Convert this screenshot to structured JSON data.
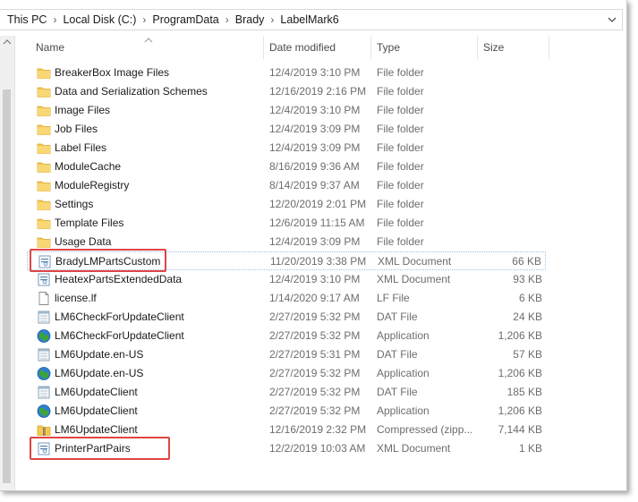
{
  "address_bar": {
    "crumbs": [
      "This PC",
      "Local Disk (C:)",
      "ProgramData",
      "Brady",
      "LabelMark6"
    ]
  },
  "columns": {
    "name": "Name",
    "date": "Date modified",
    "type": "Type",
    "size": "Size"
  },
  "files": [
    {
      "name": "BreakerBox Image Files",
      "date": "12/4/2019 3:10 PM",
      "type": "File folder",
      "size": "",
      "icon": "folder-icon"
    },
    {
      "name": "Data and Serialization Schemes",
      "date": "12/16/2019 2:16 PM",
      "type": "File folder",
      "size": "",
      "icon": "folder-icon"
    },
    {
      "name": "Image Files",
      "date": "12/4/2019 3:10 PM",
      "type": "File folder",
      "size": "",
      "icon": "folder-icon"
    },
    {
      "name": "Job Files",
      "date": "12/4/2019 3:09 PM",
      "type": "File folder",
      "size": "",
      "icon": "folder-icon"
    },
    {
      "name": "Label Files",
      "date": "12/4/2019 3:09 PM",
      "type": "File folder",
      "size": "",
      "icon": "folder-icon"
    },
    {
      "name": "ModuleCache",
      "date": "8/16/2019 9:36 AM",
      "type": "File folder",
      "size": "",
      "icon": "folder-icon"
    },
    {
      "name": "ModuleRegistry",
      "date": "8/14/2019 9:37 AM",
      "type": "File folder",
      "size": "",
      "icon": "folder-icon"
    },
    {
      "name": "Settings",
      "date": "12/20/2019 2:01 PM",
      "type": "File folder",
      "size": "",
      "icon": "folder-icon"
    },
    {
      "name": "Template Files",
      "date": "12/6/2019 11:15 AM",
      "type": "File folder",
      "size": "",
      "icon": "folder-icon"
    },
    {
      "name": "Usage Data",
      "date": "12/4/2019 3:09 PM",
      "type": "File folder",
      "size": "",
      "icon": "folder-icon"
    },
    {
      "name": "BradyLMPartsCustom",
      "date": "11/20/2019 3:38 PM",
      "type": "XML Document",
      "size": "66 KB",
      "icon": "xml-document-icon",
      "highlighted": true,
      "selected": true
    },
    {
      "name": "HeatexPartsExtendedData",
      "date": "12/4/2019 3:10 PM",
      "type": "XML Document",
      "size": "93 KB",
      "icon": "xml-document-icon"
    },
    {
      "name": "license.lf",
      "date": "1/14/2020 9:17 AM",
      "type": "LF File",
      "size": "6 KB",
      "icon": "blank-file-icon"
    },
    {
      "name": "LM6CheckForUpdateClient",
      "date": "2/27/2019 5:32 PM",
      "type": "DAT File",
      "size": "24 KB",
      "icon": "dat-file-icon"
    },
    {
      "name": "LM6CheckForUpdateClient",
      "date": "2/27/2019 5:32 PM",
      "type": "Application",
      "size": "1,206 KB",
      "icon": "application-icon"
    },
    {
      "name": "LM6Update.en-US",
      "date": "2/27/2019 5:31 PM",
      "type": "DAT File",
      "size": "57 KB",
      "icon": "dat-file-icon"
    },
    {
      "name": "LM6Update.en-US",
      "date": "2/27/2019 5:32 PM",
      "type": "Application",
      "size": "1,206 KB",
      "icon": "application-icon"
    },
    {
      "name": "LM6UpdateClient",
      "date": "2/27/2019 5:32 PM",
      "type": "DAT File",
      "size": "185 KB",
      "icon": "dat-file-icon"
    },
    {
      "name": "LM6UpdateClient",
      "date": "2/27/2019 5:32 PM",
      "type": "Application",
      "size": "1,206 KB",
      "icon": "application-icon"
    },
    {
      "name": "LM6UpdateClient",
      "date": "12/16/2019 2:32 PM",
      "type": "Compressed (zipp...",
      "size": "7,144 KB",
      "icon": "zip-folder-icon"
    },
    {
      "name": "PrinterPartPairs",
      "date": "12/2/2019 10:03 AM",
      "type": "XML Document",
      "size": "1 KB",
      "icon": "xml-document-icon",
      "highlighted": true
    }
  ],
  "colors": {
    "highlight_border": "#e04545",
    "folder": "#f3c94e",
    "selection_outline": "#9dc4e7"
  }
}
